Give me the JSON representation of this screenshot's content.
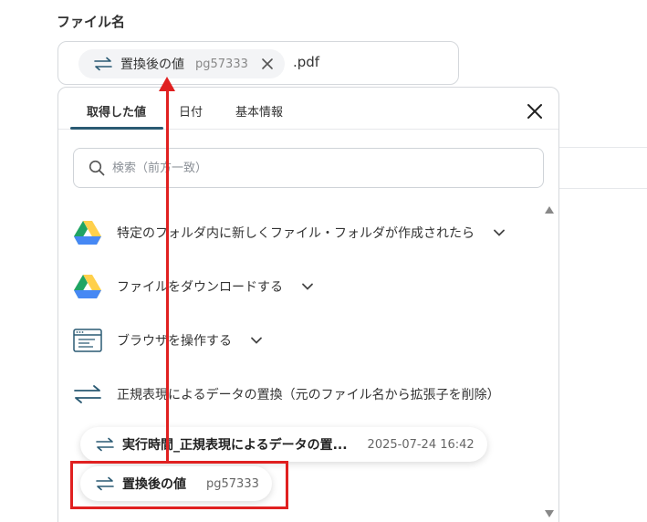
{
  "field": {
    "label": "ファイル名",
    "extension": ".pdf"
  },
  "token": {
    "label": "置換後の値",
    "id": "pg57333",
    "icon": "swap-arrows-icon"
  },
  "tabs": [
    {
      "label": "取得した値",
      "active": true
    },
    {
      "label": "日付",
      "active": false
    },
    {
      "label": "基本情報",
      "active": false
    }
  ],
  "search": {
    "placeholder": "検索（前方一致）"
  },
  "items": [
    {
      "label": "特定のフォルダ内に新しくファイル・フォルダが作成されたら",
      "icon": "google-drive-icon"
    },
    {
      "label": "ファイルをダウンロードする",
      "icon": "google-drive-icon"
    },
    {
      "label": "ブラウザを操作する",
      "icon": "browser-window-icon"
    },
    {
      "label": "正規表現によるデータの置換（元のファイル名から拡張子を削除）",
      "icon": "swap-arrows-icon"
    }
  ],
  "results": [
    {
      "label": "実行時間_正規表現によるデータの置...",
      "value": "2025-07-24 16:42"
    },
    {
      "label": "置換後の値",
      "value": "pg57333"
    }
  ],
  "colors": {
    "accent": "#2a5a73",
    "highlight": "#e02020",
    "drive_green": "#1fa463",
    "drive_yellow": "#ffd04b",
    "drive_blue": "#4688f4"
  }
}
